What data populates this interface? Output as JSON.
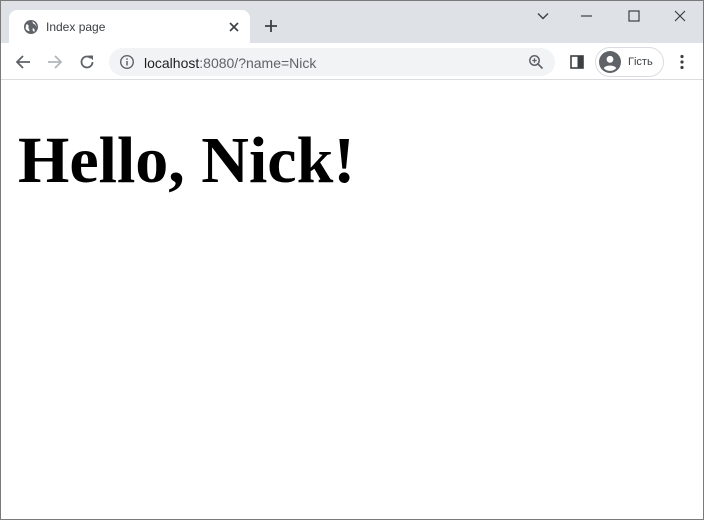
{
  "tab": {
    "title": "Index page",
    "favicon": "globe-icon"
  },
  "toolbar": {
    "url_host": "localhost",
    "url_rest": ":8080/?name=Nick",
    "profile_label": "Гість"
  },
  "page": {
    "heading": "Hello, Nick!"
  },
  "colors": {
    "tabstrip": "#dee1e6",
    "omnibox": "#f1f3f4",
    "icon": "#5f6368",
    "text": "#202124"
  }
}
